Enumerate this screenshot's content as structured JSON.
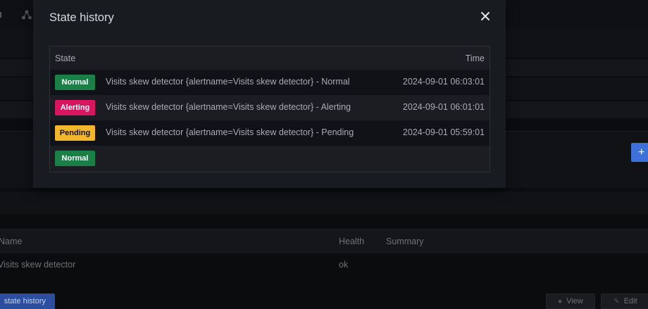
{
  "modal": {
    "title": "State history",
    "table": {
      "header_state": "State",
      "header_time": "Time",
      "rows": [
        {
          "state": "Normal",
          "text": "Visits skew detector {alertname=Visits skew detector} - Normal",
          "time": "2024-09-01 06:03:01"
        },
        {
          "state": "Alerting",
          "text": "Visits skew detector {alertname=Visits skew detector} - Alerting",
          "time": "2024-09-01 06:01:01"
        },
        {
          "state": "Pending",
          "text": "Visits skew detector {alertname=Visits skew detector} - Pending",
          "time": "2024-09-01 05:59:01"
        },
        {
          "state": "Normal",
          "text": "",
          "time": ""
        }
      ]
    }
  },
  "background": {
    "list_headers": {
      "name": "Name",
      "health": "Health",
      "summary": "Summary"
    },
    "rule": {
      "name": "Visits skew detector",
      "health": "ok"
    },
    "buttons": {
      "state_history": "state history",
      "view": "View",
      "edit": "Edit",
      "add": "+"
    }
  },
  "colors": {
    "normal": "#1b7f48",
    "alerting": "#d8155f",
    "pending": "#f3b72d",
    "primary": "#3d71d9"
  },
  "icons": {
    "close": "close-icon",
    "view": "eye-icon",
    "edit": "pen-icon"
  }
}
